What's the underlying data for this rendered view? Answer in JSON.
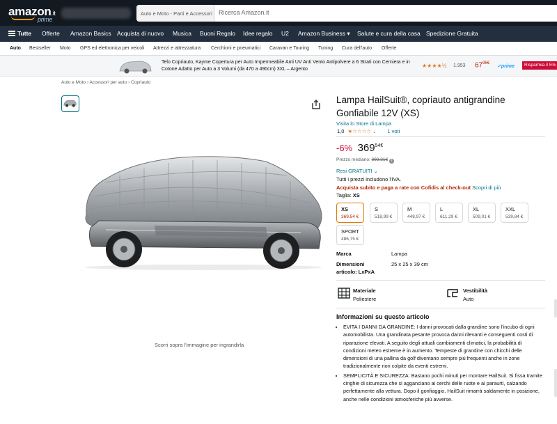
{
  "header": {
    "logo": "amazon",
    "logo_tld": ".it",
    "logo_sub": "prime",
    "search_category": "Auto e Moto - Parti e Accessori",
    "search_placeholder": "Ricerca Amazon.it"
  },
  "nav": {
    "menu_label": "Tutte",
    "items": [
      "Offerte",
      "Amazon Basics",
      "Acquista di nuovo",
      "Musica",
      "Buoni Regalo",
      "Idee regalo",
      "U2",
      "Amazon Business",
      "Salute e cura della casa",
      "Spedizione Gratuita"
    ]
  },
  "subnav": {
    "items": [
      "Auto",
      "Bestseller",
      "Moto",
      "GPS ed elettronica per veicoli",
      "Attrezzi e attrezzatura",
      "Cerchioni e pneumatici",
      "Caravan e Touring",
      "Tuning",
      "Cura dell'auto",
      "Offerte"
    ]
  },
  "sponsored": {
    "text": "Telo Copriauto, Kayme Copertura per Auto Impermeabile Anti UV Anti Vento Antipolvere a 6 Strati con Cerniera e in Cotone Adatto per Auto a 3 Volumi (da 470 a 490cm) 3XL – Argento",
    "stars": "★★★★½",
    "rating_count": "1.953",
    "price_int": "67",
    "price_dec": "96",
    "currency": "€",
    "prime": "✓prime",
    "badge": "Risparmia il 5%"
  },
  "breadcrumb": "Auto e Moto › Accessori per auto › Copriauto",
  "zoom_hint": "Scorri sopra l'immagine per ingrandirla",
  "product": {
    "title": "Lampa HailSuit®, copriauto antigrandine Gonfiabile 12V (XS)",
    "store_link": "Visita lo Store di Lampa",
    "rating": "1,0",
    "stars": "★☆☆☆☆",
    "votes": "1 voti",
    "discount": "-6%",
    "price_int": "369",
    "price_dec": "54",
    "currency": "€",
    "median_label": "Prezzo mediano:",
    "median_price": "392,21€",
    "returns": "Resi GRATUITI",
    "vat": "Tutti i prezzi includono l'IVA.",
    "promo_bold": "Acquista subito e paga a rate con Cofidis al check-out",
    "promo_link": "Scopri di più",
    "size_label": "Taglia:",
    "size_value": "XS",
    "sizes": [
      {
        "name": "XS",
        "price": "369,54 €"
      },
      {
        "name": "S",
        "price": "518,99 €"
      },
      {
        "name": "M",
        "price": "448,97 €"
      },
      {
        "name": "L",
        "price": "611,29 €"
      },
      {
        "name": "XL",
        "price": "509,01 €"
      },
      {
        "name": "XXL",
        "price": "539,84 €"
      },
      {
        "name": "SPORT",
        "price": "486,75 €"
      }
    ],
    "specs": [
      {
        "key": "Marca",
        "value": "Lampa"
      },
      {
        "key": "Dimensioni articolo: LxPxA",
        "value": "25 x 25 x 39 cm"
      }
    ],
    "features": [
      {
        "key": "Materiale",
        "value": "Poliestere"
      },
      {
        "key": "Vestibilità",
        "value": "Auto"
      }
    ],
    "about_heading": "Informazioni su questo articolo",
    "about": [
      "EVITA I DANNI DA GRANDINE: I danni provocati dalla grandine sono l'incubo di ogni automobilista. Una grandinata pesante provoca danni rilevanti e conseguenti costi di riparazione elevati. A seguito degli attuali cambiamenti climatici, la probabilità di condizioni meteo estreme è in aumento. Tempeste di grandine con chicchi delle dimensioni di una pallina da golf diventano sempre più frequenti anche in zone tradizionalmente non colpite da eventi estremi.",
      "SEMPLICITÀ E SICUREZZA: Bastano pochi minuti per montare HailSuit. Si fissa tramite cinghie di sicurezza che si agganciano ai cerchi delle ruote e ai paraurti, calzando perfettamente alla vettura. Dopo il gonfiaggio, HailSuit rimarrà saldamente in posizione, anche nelle condizioni atmosferiche più avverse."
    ]
  },
  "colors": {
    "topbar": "#131921",
    "navbar": "#232f3e",
    "link": "#007185",
    "discount": "#cc0c39",
    "accent": "#ff9900"
  }
}
